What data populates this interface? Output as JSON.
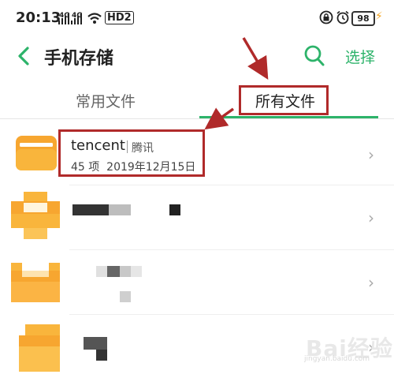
{
  "status_bar": {
    "time": "20:13",
    "signal1": "4G",
    "signal2": "4G",
    "hd": "HD2",
    "battery": "98"
  },
  "header": {
    "title": "手机存储",
    "select_label": "选择"
  },
  "tabs": [
    {
      "label": "常用文件",
      "active": false
    },
    {
      "label": "所有文件",
      "active": true
    }
  ],
  "list": {
    "items": [
      {
        "name": "tencent",
        "tag": "腾讯",
        "count": "45 项",
        "date": "2019年12月15日",
        "chevron": "›"
      },
      {
        "chevron": "›"
      },
      {
        "chevron": "›"
      },
      {
        "chevron": "›"
      }
    ]
  },
  "watermark": {
    "text": "Bai经验",
    "sub": "jingyan.baidu.com"
  },
  "colors": {
    "accent": "#2db36a",
    "folder": "#f7a630",
    "annotation": "#b02a2a"
  }
}
